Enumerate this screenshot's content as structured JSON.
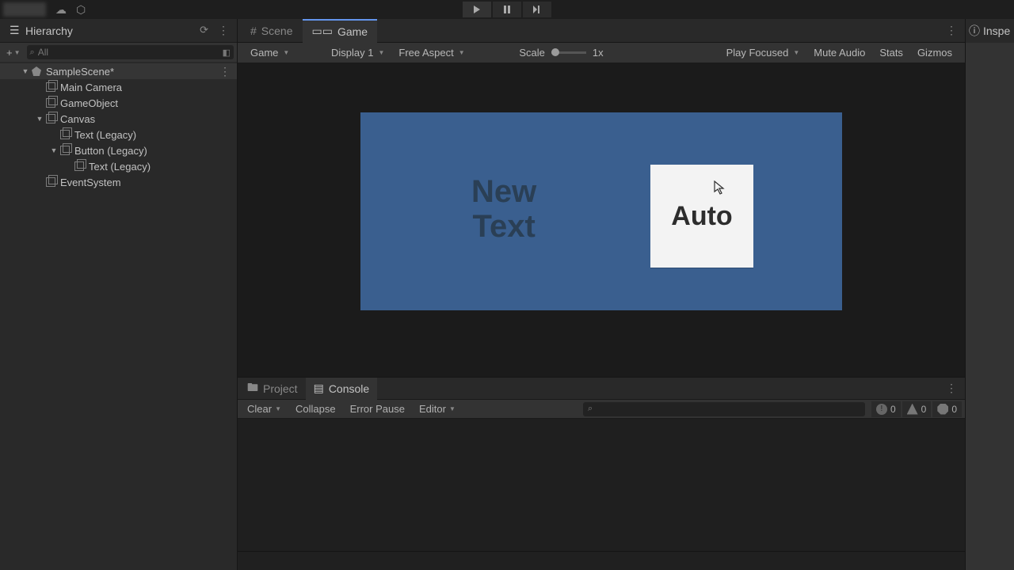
{
  "titlebar": {
    "cloud_icon": "cloud",
    "cube_icon": "package"
  },
  "playback": {
    "play": "Play",
    "pause": "Pause",
    "step": "Step"
  },
  "hierarchy": {
    "title": "Hierarchy",
    "search_placeholder": "All",
    "plus_label": "+",
    "root": "SampleScene*",
    "items": [
      {
        "label": "Main Camera",
        "indent": 2
      },
      {
        "label": "GameObject",
        "indent": 2
      },
      {
        "label": "Canvas",
        "indent": 2,
        "expandable": true
      },
      {
        "label": "Text (Legacy)",
        "indent": 3
      },
      {
        "label": "Button (Legacy)",
        "indent": 3,
        "expandable": true
      },
      {
        "label": "Text (Legacy)",
        "indent": 4
      },
      {
        "label": "EventSystem",
        "indent": 2
      }
    ]
  },
  "scene_tabs": {
    "scene": "Scene",
    "game": "Game"
  },
  "game_toolbar": {
    "mode": "Game",
    "display": "Display 1",
    "aspect": "Free Aspect",
    "scale_label": "Scale",
    "scale_value": "1x",
    "play_focused": "Play Focused",
    "mute": "Mute Audio",
    "stats": "Stats",
    "gizmos": "Gizmos"
  },
  "game_view": {
    "new_text_line1": "New",
    "new_text_line2": "Text",
    "button_label": "Auto"
  },
  "inspector": {
    "title": "Inspe"
  },
  "bottom": {
    "project": "Project",
    "console": "Console",
    "clear": "Clear",
    "collapse": "Collapse",
    "error_pause": "Error Pause",
    "editor": "Editor",
    "counts": {
      "info": "0",
      "warn": "0",
      "err": "0"
    }
  }
}
